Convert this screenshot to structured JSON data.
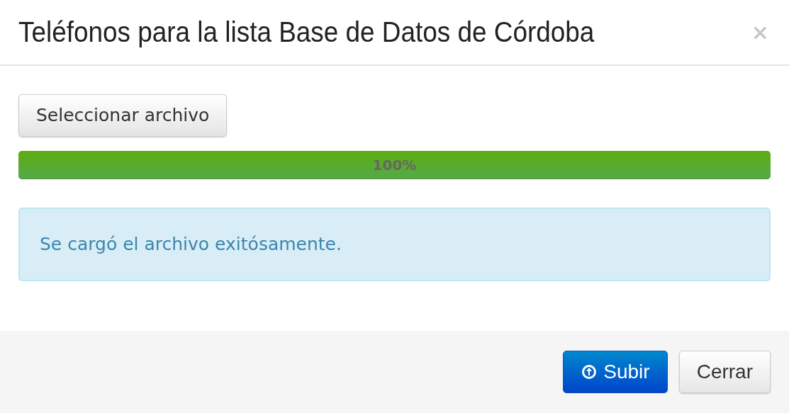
{
  "modal": {
    "title": "Teléfonos para la lista Base de Datos de Córdoba",
    "close": "×"
  },
  "file_button": "Seleccionar archivo",
  "progress": {
    "level": 1.0,
    "label": "100%"
  },
  "alert": {
    "text": "Se cargó el archivo exitósamente."
  },
  "buttons": [
    {
      "kind": "primary",
      "label": "Subir"
    },
    {
      "kind": "default",
      "label": "Cerrar"
    }
  ]
}
